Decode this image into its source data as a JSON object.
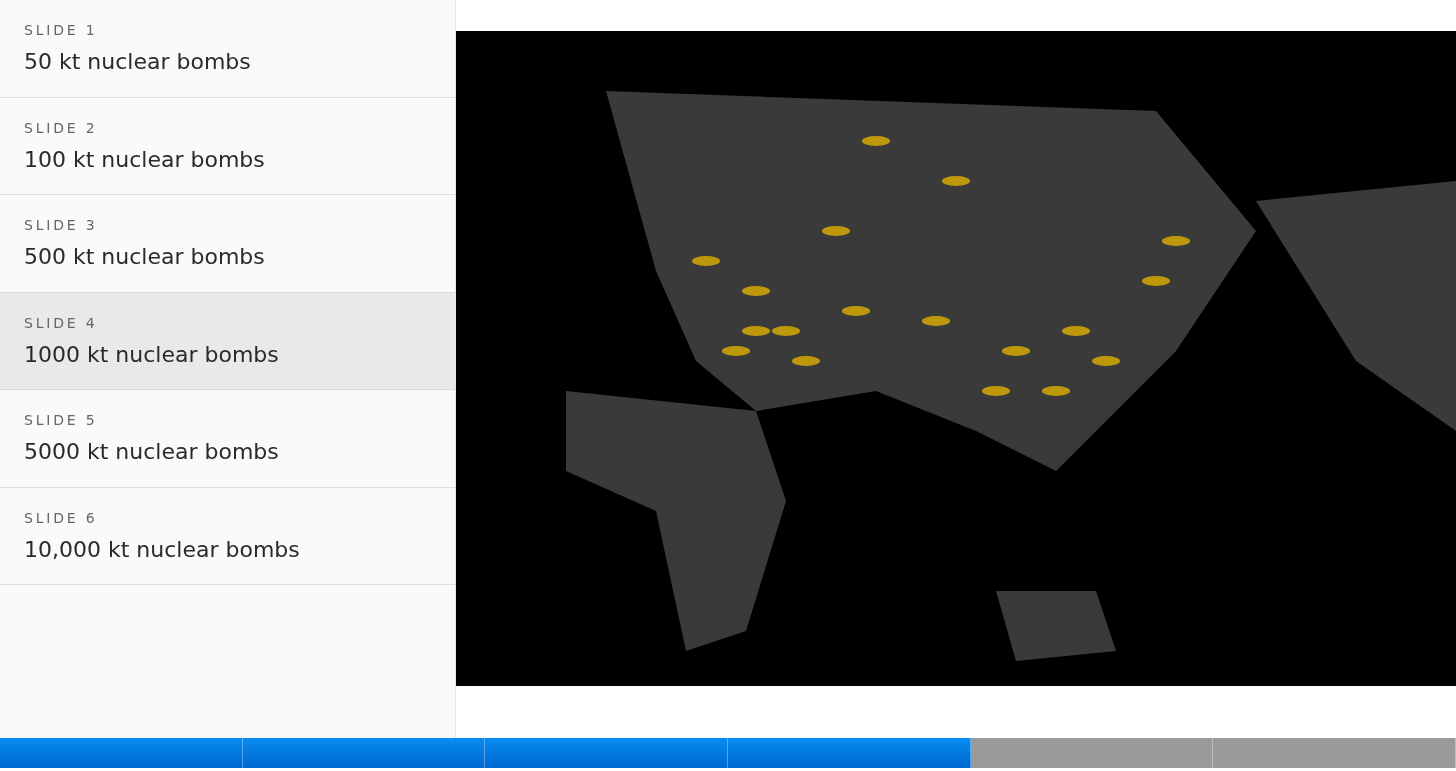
{
  "slides": [
    {
      "label": "SLIDE 1",
      "title": "50 kt nuclear bombs",
      "selected": false
    },
    {
      "label": "SLIDE 2",
      "title": "100 kt nuclear bombs",
      "selected": false
    },
    {
      "label": "SLIDE 3",
      "title": "500 kt nuclear bombs",
      "selected": false
    },
    {
      "label": "SLIDE 4",
      "title": "1000 kt nuclear bombs",
      "selected": true
    },
    {
      "label": "SLIDE 5",
      "title": "5000 kt nuclear bombs",
      "selected": false
    },
    {
      "label": "SLIDE 6",
      "title": "10,000 kt nuclear bombs",
      "selected": false
    }
  ],
  "progress_segments": [
    {
      "completed": true
    },
    {
      "completed": true
    },
    {
      "completed": true
    },
    {
      "completed": true
    },
    {
      "completed": false
    },
    {
      "completed": false
    }
  ]
}
